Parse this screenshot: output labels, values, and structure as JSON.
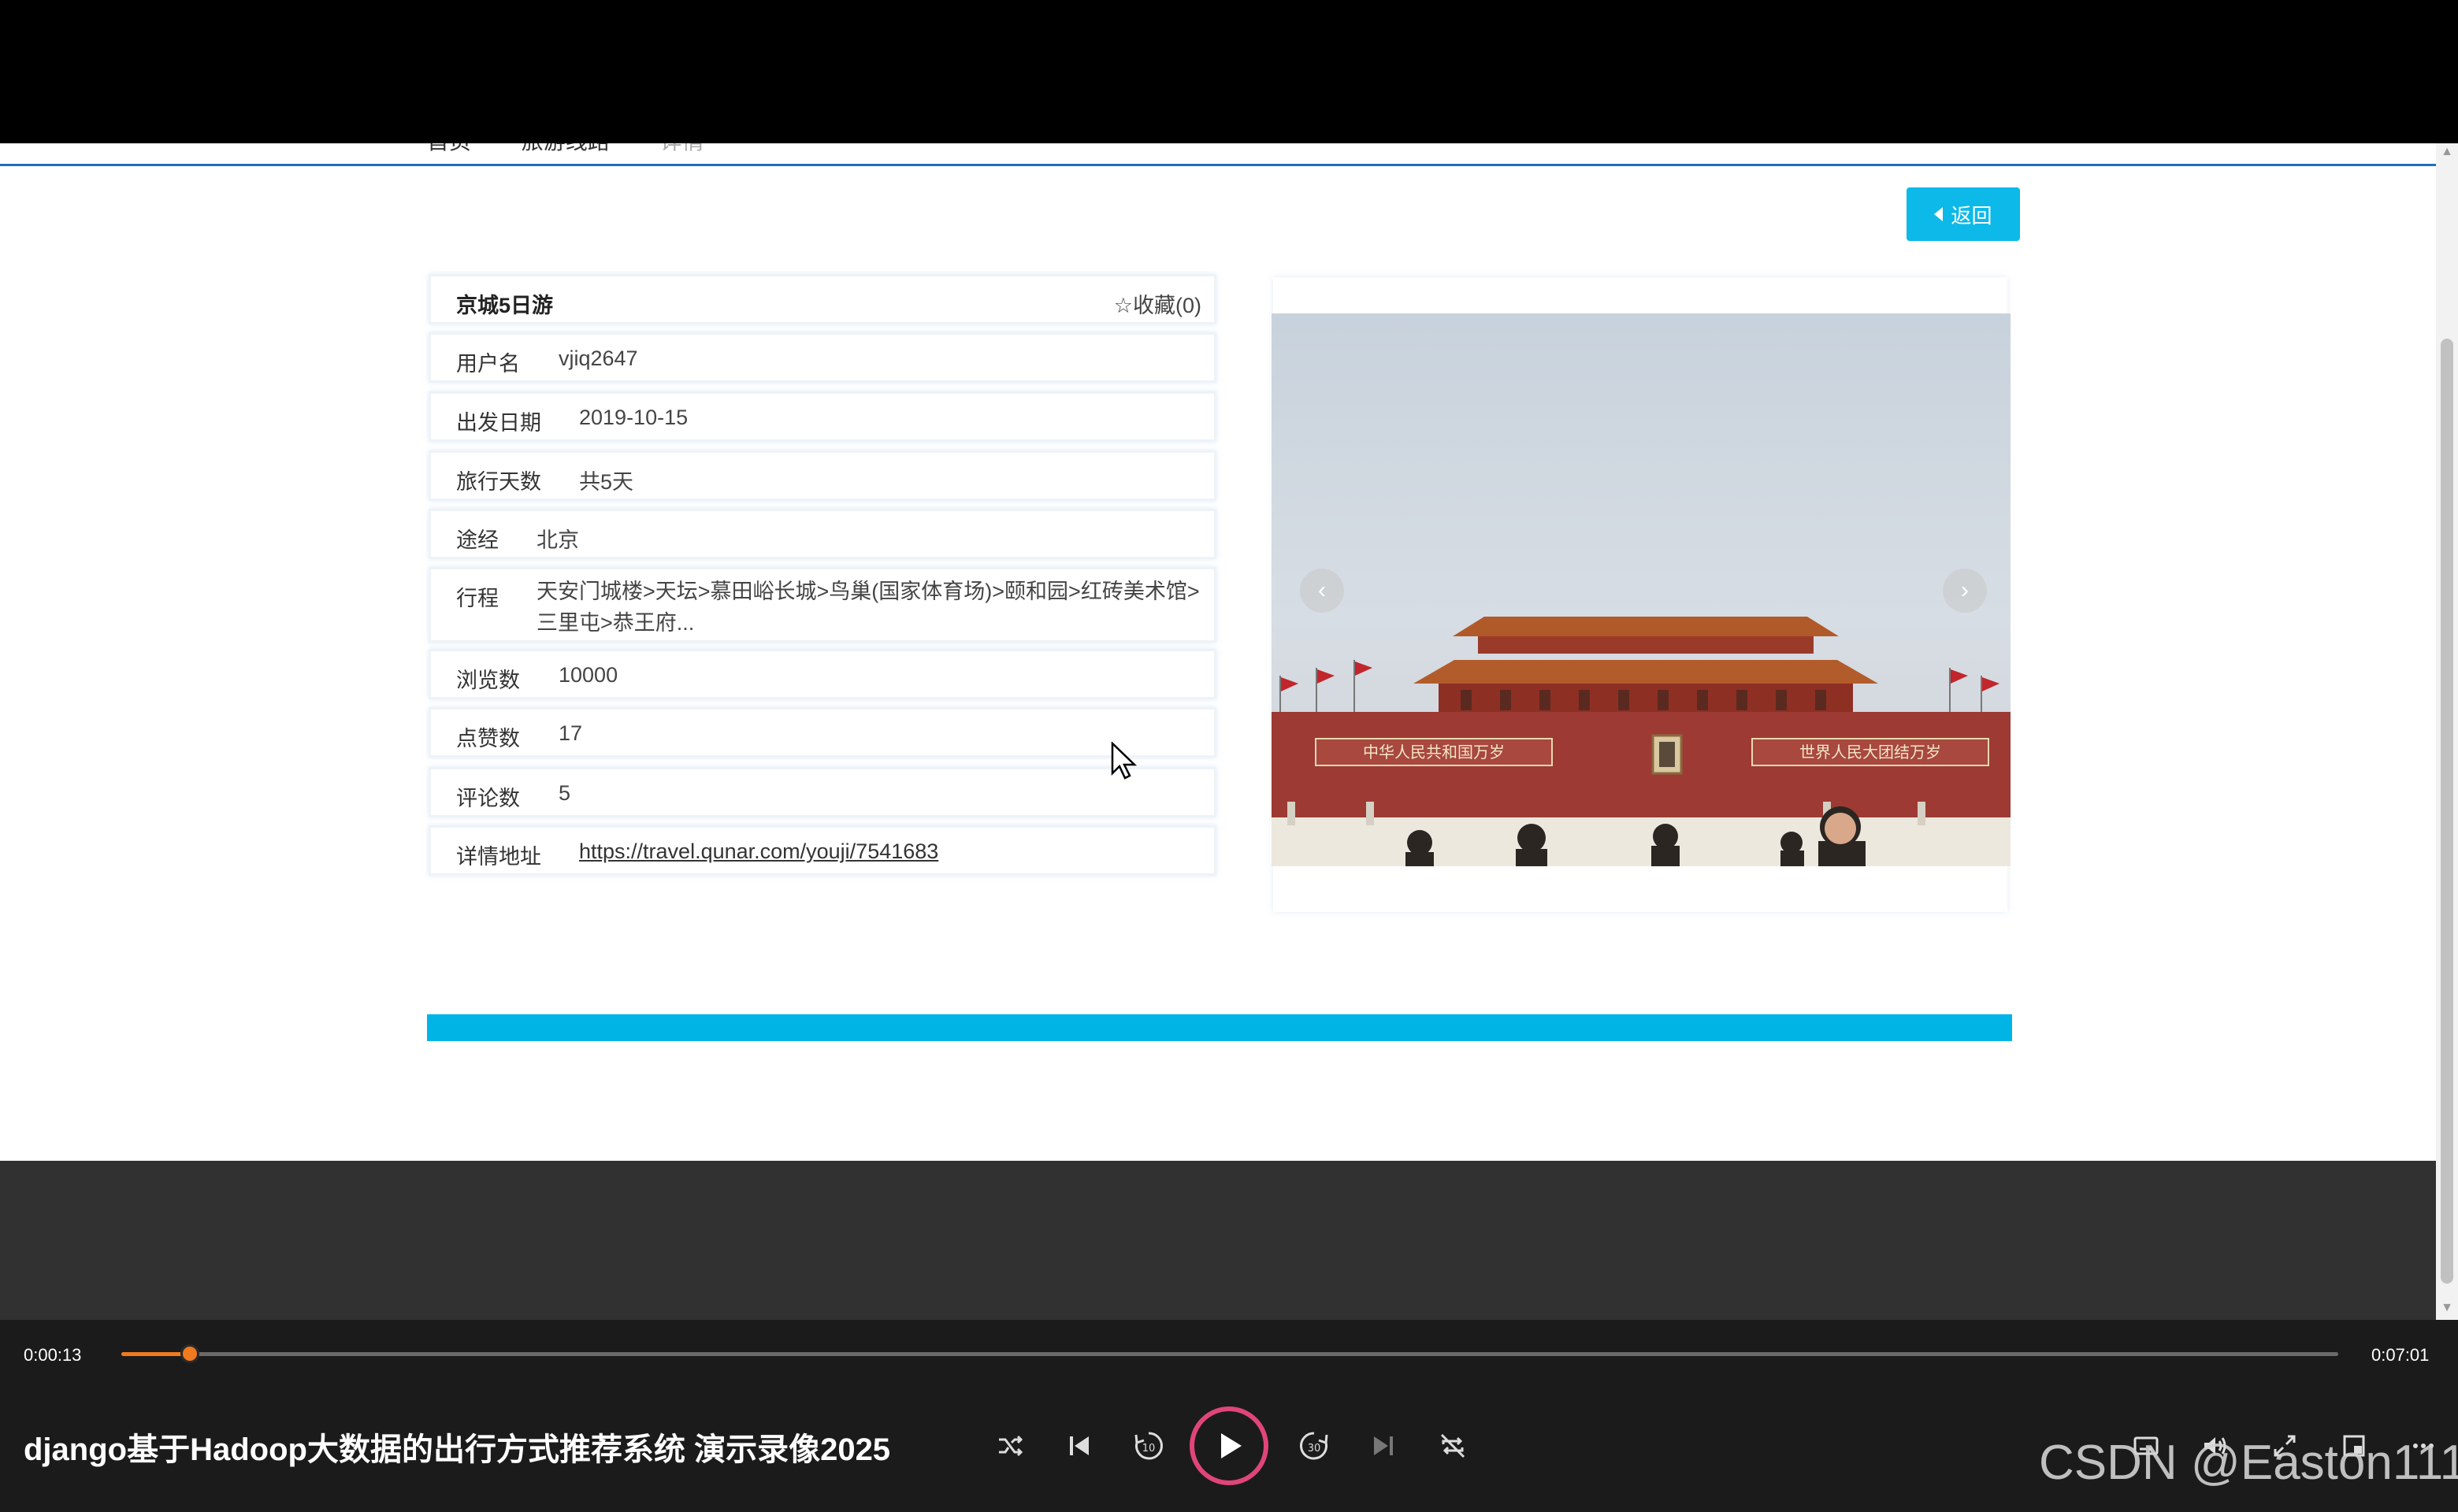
{
  "breadcrumb": {
    "items": [
      "首页",
      "旅游线路",
      "详情"
    ]
  },
  "back_button": {
    "label": "返回"
  },
  "detail": {
    "title": "京城5日游",
    "favorite_label": "收藏(0)",
    "rows": [
      {
        "label": "用户名",
        "value": "vjiq2647"
      },
      {
        "label": "出发日期",
        "value": "2019-10-15"
      },
      {
        "label": "旅行天数",
        "value": "共5天"
      },
      {
        "label": "途经",
        "value": "北京"
      },
      {
        "label": "行程",
        "value": "天安门城楼>天坛>慕田峪长城>鸟巢(国家体育场)>颐和园>红砖美术馆>三里屯>恭王府..."
      },
      {
        "label": "浏览数",
        "value": "10000"
      },
      {
        "label": "点赞数",
        "value": "17"
      },
      {
        "label": "评论数",
        "value": "5"
      },
      {
        "label": "详情地址",
        "value": "https://travel.qunar.com/youji/7541683"
      }
    ]
  },
  "carousel": {
    "prev_glyph": "‹",
    "next_glyph": "›",
    "photo_text": {
      "left_banner": "中华人民共和国万岁",
      "right_banner": "世界人民大团结万岁"
    }
  },
  "player": {
    "current_time": "0:00:13",
    "total_time": "0:07:01",
    "progress": 0.031,
    "title": "django基于Hadoop大数据的出行方式推荐系统 演示录像2025",
    "controls": [
      "shuffle-icon",
      "previous-icon",
      "rewind-10-icon",
      "play-icon",
      "forward-30-icon",
      "next-icon",
      "repeat-off-icon",
      "subtitles-icon",
      "volume-icon",
      "fullscreen-icon",
      "mini-player-icon",
      "more-icon"
    ],
    "skip_back_label": "10",
    "skip_forward_label": "30"
  },
  "watermark": "CSDN @Easton111",
  "colors": {
    "accent": "#0db9e8",
    "progress": "#f07a1e",
    "play_ring": "#e0457a"
  }
}
